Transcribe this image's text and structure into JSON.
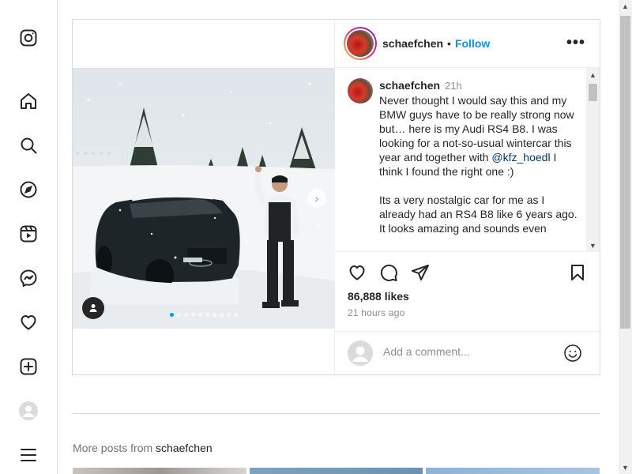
{
  "nav": {
    "items": [
      "instagram-logo",
      "home",
      "search",
      "explore",
      "reels",
      "messages",
      "notifications",
      "create",
      "profile",
      "more"
    ]
  },
  "post": {
    "username": "schaefchen",
    "separator": "•",
    "follow_label": "Follow",
    "more_label": "•••",
    "caption_username": "schaefchen",
    "caption_time": "21h",
    "caption_part1": "Never thought I would say this and my BMW guys have to be really strong now but… here is my Audi RS4 B8. I was looking for a not-so-usual wintercar this year and together with ",
    "caption_mention": "@kfz_hoedl",
    "caption_part2": " I think I found the right one :)\n\nIts a very nostalgic car for me as I already had an RS4 B8 like 6 years ago. It looks amazing and sounds even",
    "likes": "86,888 likes",
    "posted": "21 hours ago",
    "comment_placeholder": "Add a comment...",
    "carousel_count": 10,
    "carousel_active": 0
  },
  "more_posts": {
    "prefix": "More posts from ",
    "username": "schaefchen"
  },
  "colors": {
    "accent": "#0095f6",
    "border": "#dbdbdb",
    "muted": "#8e8e8e"
  }
}
